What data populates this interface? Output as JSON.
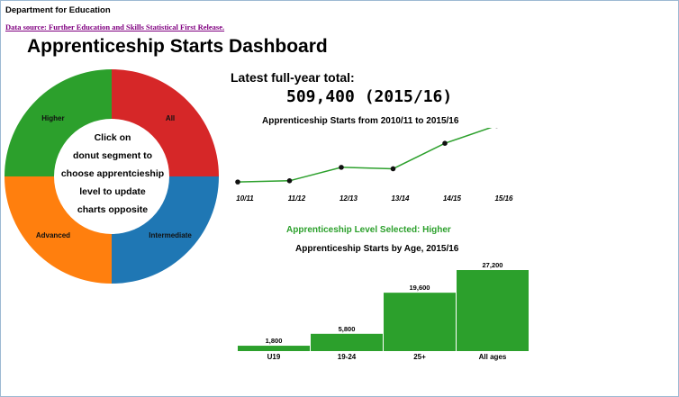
{
  "header": {
    "department": "Department for Education",
    "source_link": "Data source: Further Education and Skills Statistical First Release."
  },
  "title": "Apprenticeship Starts Dashboard",
  "donut": {
    "center_lines": [
      "Click on",
      "donut segment to",
      "choose apprentcieship",
      "level to update",
      "charts opposite"
    ],
    "colors": {
      "All": "#d62728",
      "Intermediate": "#1f77b4",
      "Advanced": "#ff7f0e",
      "Higher": "#2ca02c"
    }
  },
  "summary": {
    "label": "Latest full-year total:",
    "value": "509,400 (2015/16)"
  },
  "level_selected": "Apprenticeship Level Selected: Higher",
  "accent_color": "#2ca02c",
  "chart_data": [
    {
      "type": "pie",
      "categories": [
        "All",
        "Intermediate",
        "Advanced",
        "Higher"
      ],
      "values": [
        25,
        25,
        25,
        25
      ]
    },
    {
      "type": "line",
      "title": "Apprenticeship Starts from 2010/11 to 2015/16",
      "categories": [
        "10/11",
        "11/12",
        "12/13",
        "13/14",
        "14/15",
        "15/16"
      ],
      "values": [
        3700,
        4200,
        9800,
        9200,
        19800,
        27200
      ],
      "ylim": [
        0,
        30000
      ],
      "grid": false
    },
    {
      "type": "bar",
      "title": "Apprenticeship Starts by Age, 2015/16",
      "categories": [
        "U19",
        "19-24",
        "25+",
        "All ages"
      ],
      "values": [
        1800,
        5800,
        19600,
        27200
      ],
      "value_labels": [
        "1,800",
        "5,800",
        "19,600",
        "27,200"
      ],
      "ylim": [
        0,
        27200
      ]
    }
  ]
}
